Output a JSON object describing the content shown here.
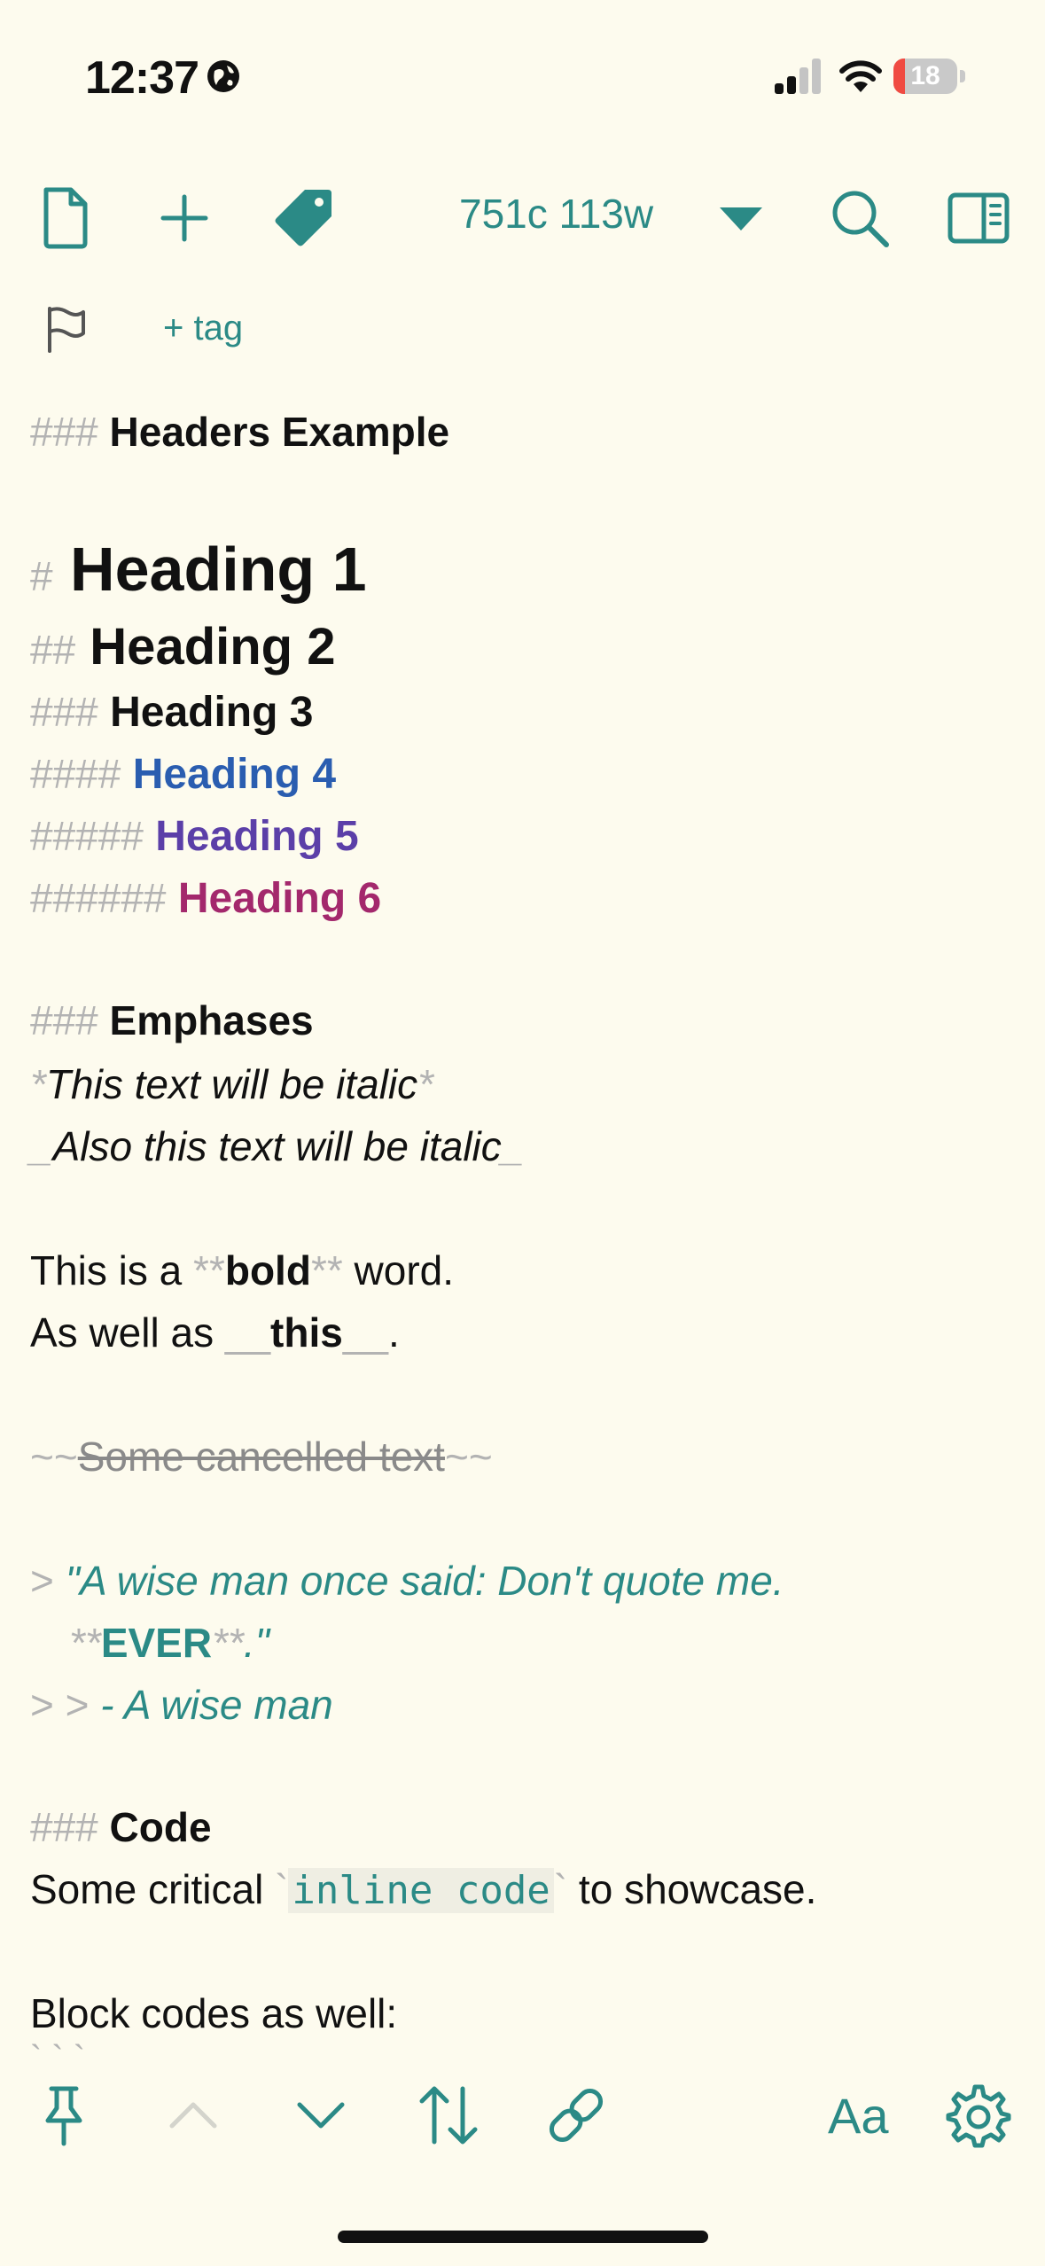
{
  "status_bar": {
    "time": "12:37",
    "battery_level": "18",
    "battery_fraction": 0.18
  },
  "toolbar": {
    "icons": [
      "document-icon",
      "plus-icon",
      "tag-icon",
      "triangle-down-icon",
      "search-icon",
      "sidebar-icon"
    ],
    "counter": "751c 113w",
    "tag_link": "+ tag"
  },
  "editor": {
    "headers_example": {
      "marker": "###",
      "text": "Headers Example"
    },
    "h1": {
      "marker": "#",
      "text": "Heading 1"
    },
    "h2": {
      "marker": "##",
      "text": "Heading 2"
    },
    "h3": {
      "marker": "###",
      "text": "Heading 3"
    },
    "h4": {
      "marker": "####",
      "text": "Heading 4",
      "color": "#2a5db0"
    },
    "h5": {
      "marker": "#####",
      "text": "Heading 5",
      "color": "#5b3fa8"
    },
    "h6": {
      "marker": "######",
      "text": "Heading 6",
      "color": "#a3286c"
    },
    "emphases": {
      "marker": "###",
      "text": "Emphases"
    },
    "italic1": {
      "marker_open": "*",
      "text": "This text will be italic",
      "marker_close": "*"
    },
    "italic2": {
      "marker_open": "_",
      "text": "Also this text will be italic",
      "marker_close": "_"
    },
    "bold_line": {
      "before": "This is a ",
      "marker_open": "**",
      "bold": "bold",
      "marker_close": "**",
      "after": " word."
    },
    "bold_line2": {
      "before": "As well as ",
      "marker_open": "__",
      "bold": "this",
      "marker_close": "__",
      "after": "."
    },
    "strike_line": {
      "marker_open": "~~",
      "text": "Some cancelled text",
      "marker_close": "~~"
    },
    "quote1": {
      "marker": ">",
      "text": "\"A wise man once said: Don't quote me."
    },
    "quote1b": {
      "marker_open": "**",
      "bold": "EVER",
      "marker_close": "**",
      "after": ".\""
    },
    "quote2": {
      "marker": "> >",
      "text": "- A wise man"
    },
    "code_heading": {
      "marker": "###",
      "text": "Code"
    },
    "code_line": {
      "before": "Some critical ",
      "tick_open": "`",
      "code": "inline code",
      "tick_close": "`",
      "after": " to showcase."
    },
    "block_line": "Block codes as well:",
    "fence_partial": "` ` `"
  },
  "bottom_bar": {
    "icons": [
      "pin-icon",
      "chevron-up-icon",
      "chevron-down-icon",
      "sort-icon",
      "link-icon",
      "gear-icon"
    ],
    "font_label": "Aa"
  },
  "colors": {
    "accent": "#2b8a86",
    "background": "#fdfbee",
    "marker": "#b3b3b3"
  }
}
